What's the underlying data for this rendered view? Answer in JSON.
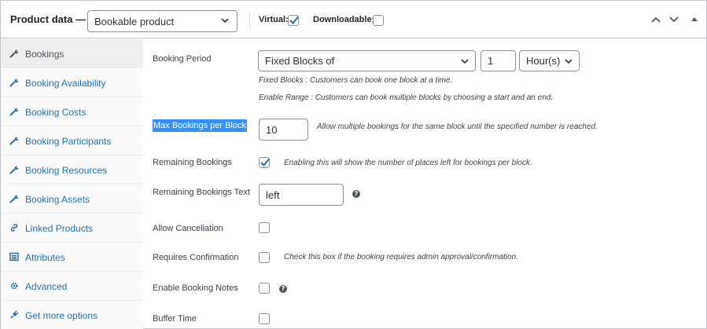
{
  "header": {
    "title": "Product data —",
    "product_type": "Bookable product",
    "virtual_label": "Virtual:",
    "virtual_checked": true,
    "downloadable_label": "Downloadable:",
    "downloadable_checked": false
  },
  "sidebar": {
    "items": [
      {
        "label": "Bookings",
        "icon": "wrench-icon",
        "active": true
      },
      {
        "label": "Booking Availability",
        "icon": "wrench-icon"
      },
      {
        "label": "Booking Costs",
        "icon": "wrench-icon"
      },
      {
        "label": "Booking Participants",
        "icon": "wrench-icon"
      },
      {
        "label": "Booking Resources",
        "icon": "wrench-icon"
      },
      {
        "label": "Booking Assets",
        "icon": "wrench-icon"
      },
      {
        "label": "Linked Products",
        "icon": "link-icon"
      },
      {
        "label": "Attributes",
        "icon": "list-icon"
      },
      {
        "label": "Advanced",
        "icon": "gear-icon"
      },
      {
        "label": "Get more options",
        "icon": "plugin-icon"
      }
    ]
  },
  "fields": {
    "booking_period": {
      "label": "Booking Period",
      "mode": "Fixed Blocks of",
      "count": "1",
      "unit": "Hour(s)",
      "desc1": "Fixed Blocks : Customers can book one block at a time.",
      "desc2": "Enable Range : Customers can book multiple blocks by choosing a start and an end."
    },
    "max_bookings": {
      "label": "Max Bookings per Block",
      "value": "10",
      "desc": "Allow multiple bookings for the same block until the specified number is reached."
    },
    "remaining_bookings": {
      "label": "Remaining Bookings",
      "checked": true,
      "desc": "Enabling this will show the number of places left for bookings per block."
    },
    "remaining_text": {
      "label": "Remaining Bookings Text",
      "value": "left"
    },
    "allow_cancellation": {
      "label": "Allow Cancellation",
      "checked": false
    },
    "requires_confirmation": {
      "label": "Requires Confirmation",
      "checked": false,
      "desc": "Check this box if the booking requires admin approval/confirmation."
    },
    "enable_notes": {
      "label": "Enable Booking Notes",
      "checked": false
    },
    "buffer_time": {
      "label": "Buffer Time",
      "checked": false
    }
  },
  "colors": {
    "link": "#2271b1",
    "accent": "#2271b1",
    "highlight": "#3390ff"
  }
}
